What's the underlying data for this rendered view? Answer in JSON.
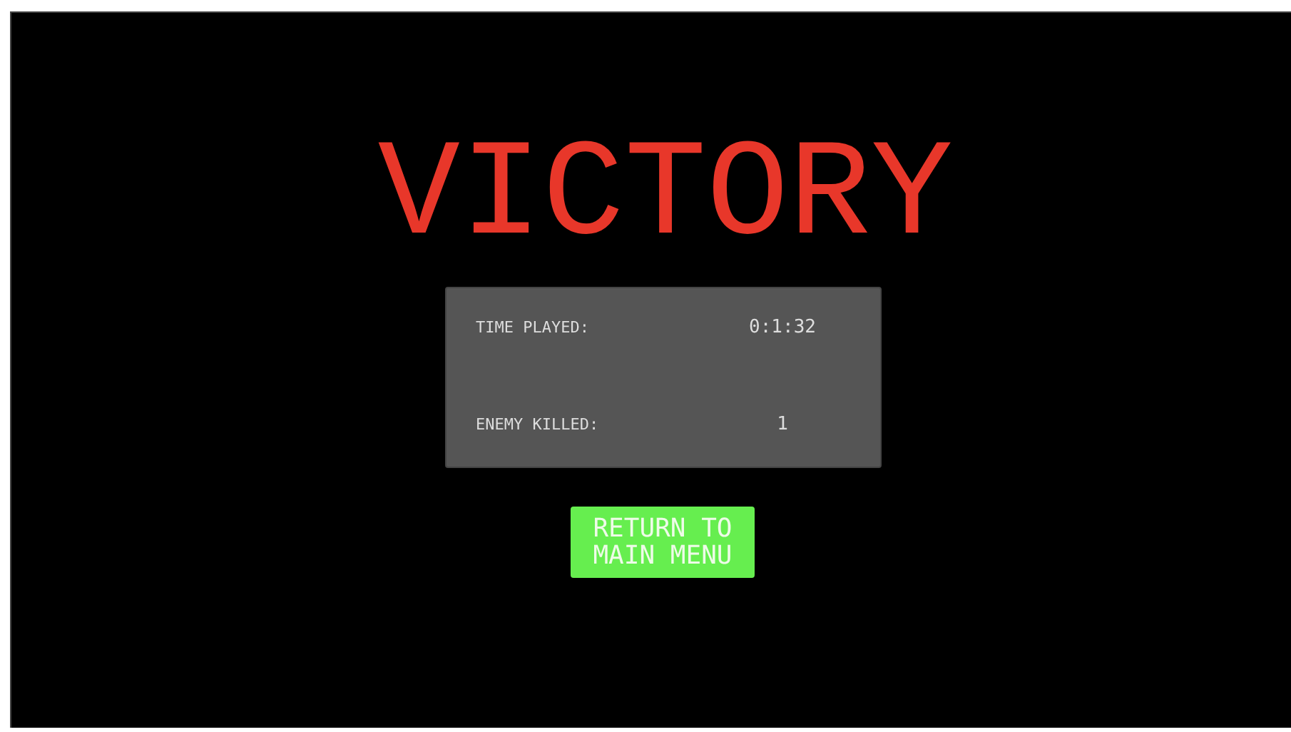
{
  "title": "VICTORY",
  "stats": [
    {
      "label": "TIME PLAYED:",
      "value": "0:1:32"
    },
    {
      "label": "ENEMY KILLED:",
      "value": "1"
    }
  ],
  "button": {
    "label": "RETURN TO MAIN MENU"
  }
}
